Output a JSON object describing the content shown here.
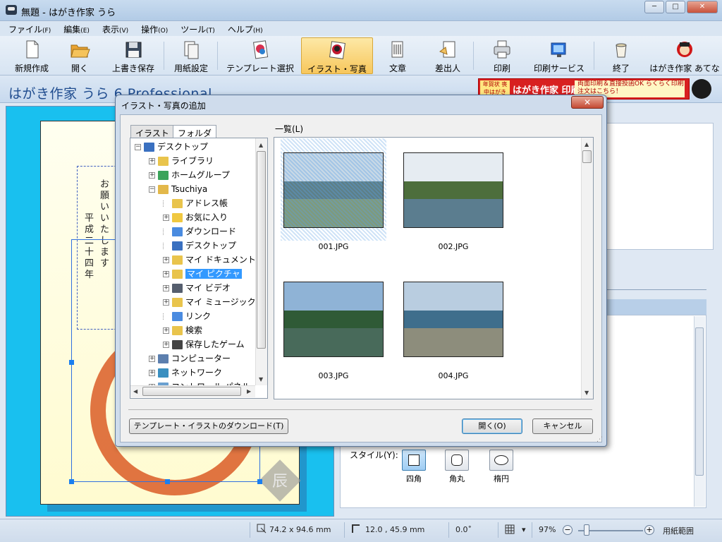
{
  "window": {
    "title": "無題 - はがき作家 うら"
  },
  "window_controls": {
    "minimize": "─",
    "maximize": "□",
    "close": "✕"
  },
  "menu": [
    {
      "label": "ファイル",
      "key": "(F)"
    },
    {
      "label": "編集",
      "key": "(E)"
    },
    {
      "label": "表示",
      "key": "(V)"
    },
    {
      "label": "操作",
      "key": "(O)"
    },
    {
      "label": "ツール",
      "key": "(T)"
    },
    {
      "label": "ヘルプ",
      "key": "(H)"
    }
  ],
  "toolbar": {
    "new": "新規作成",
    "open": "開く",
    "save": "上書き保存",
    "paper": "用紙設定",
    "template": "テンプレート選択",
    "illust": "イラスト・写真",
    "text": "文章",
    "sender": "差出人",
    "print": "印刷",
    "print_service": "印刷サービス",
    "exit": "終了",
    "address": "はがき作家 あてな"
  },
  "brand": "はがき作家 うら 6 Professional",
  "ad": {
    "left": "年賀状 喪中はがき",
    "middle": "はがき作家 印刷サービス",
    "right": "両面印刷＆直接投函OK らくらく印刷注文はこちら！"
  },
  "card": {
    "col1": "お願いいたします",
    "col2": "平成二十四年",
    "stamp": "辰"
  },
  "style_panel": {
    "label": "スタイル(Y):",
    "options": [
      {
        "label": "四角",
        "selected": true
      },
      {
        "label": "角丸",
        "selected": false
      },
      {
        "label": "楕円",
        "selected": false
      }
    ]
  },
  "status": {
    "size": "74.2 x 94.6 mm",
    "position": "12.0 , 45.9 mm",
    "angle": "0.0˚",
    "zoom": "97%",
    "zoom_level": 0.13,
    "range": "用紙範囲"
  },
  "dialog": {
    "title": "イラスト・写真の追加",
    "close": "✕",
    "tabs": [
      "イラスト",
      "フォルダ"
    ],
    "active_tab": "フォルダ",
    "list_label": "一覧(L)",
    "tree": [
      {
        "label": "デスクトップ",
        "level": 0,
        "exp": "⊟",
        "icon_color": "#3a70c0"
      },
      {
        "label": "ライブラリ",
        "level": 1,
        "exp": "+",
        "icon_color": "#e9c44c"
      },
      {
        "label": "ホームグループ",
        "level": 1,
        "exp": "+",
        "icon_color": "#3aa35a"
      },
      {
        "label": "Tsuchiya",
        "level": 1,
        "exp": "−",
        "icon_color": "#e3b84a"
      },
      {
        "label": "アドレス帳",
        "level": 2,
        "exp": "",
        "icon_color": "#e9c44c"
      },
      {
        "label": "お気に入り",
        "level": 2,
        "exp": "+",
        "icon_color": "#f0c840"
      },
      {
        "label": "ダウンロード",
        "level": 2,
        "exp": "",
        "icon_color": "#4a8be0"
      },
      {
        "label": "デスクトップ",
        "level": 2,
        "exp": "",
        "icon_color": "#3a70c0"
      },
      {
        "label": "マイ ドキュメント",
        "level": 2,
        "exp": "+",
        "icon_color": "#e9c44c"
      },
      {
        "label": "マイ ピクチャ",
        "level": 2,
        "exp": "+",
        "icon_color": "#e9c44c",
        "selected": true
      },
      {
        "label": "マイ ビデオ",
        "level": 2,
        "exp": "+",
        "icon_color": "#555e6e"
      },
      {
        "label": "マイ ミュージック",
        "level": 2,
        "exp": "+",
        "icon_color": "#e9c44c"
      },
      {
        "label": "リンク",
        "level": 2,
        "exp": "",
        "icon_color": "#4a8be0"
      },
      {
        "label": "検索",
        "level": 2,
        "exp": "+",
        "icon_color": "#e9c44c"
      },
      {
        "label": "保存したゲーム",
        "level": 2,
        "exp": "+",
        "icon_color": "#444"
      },
      {
        "label": "コンピューター",
        "level": 1,
        "exp": "+",
        "icon_color": "#5c7fae"
      },
      {
        "label": "ネットワーク",
        "level": 1,
        "exp": "+",
        "icon_color": "#3a8fc0"
      },
      {
        "label": "コントロール パネル",
        "level": 1,
        "exp": "+",
        "icon_color": "#6aa0d0"
      }
    ],
    "thumbnails": [
      {
        "caption": "001.JPG",
        "selected": true,
        "sky": "#c9d9e6",
        "mid": "#5d7f86",
        "ground": "#7f9a7a"
      },
      {
        "caption": "002.JPG",
        "selected": false,
        "sky": "#e6ecf2",
        "mid": "#4d6e3c",
        "ground": "#5b7d8f"
      },
      {
        "caption": "003.JPG",
        "selected": false,
        "sky": "#8fb3d6",
        "mid": "#2f5a36",
        "ground": "#486a5a"
      },
      {
        "caption": "004.JPG",
        "selected": false,
        "sky": "#b9cde0",
        "mid": "#3f6e8c",
        "ground": "#8d8d7c"
      }
    ],
    "download_button": "テンプレート・イラストのダウンロード(T)",
    "open_button": "開く(O)",
    "cancel_button": "キャンセル"
  }
}
